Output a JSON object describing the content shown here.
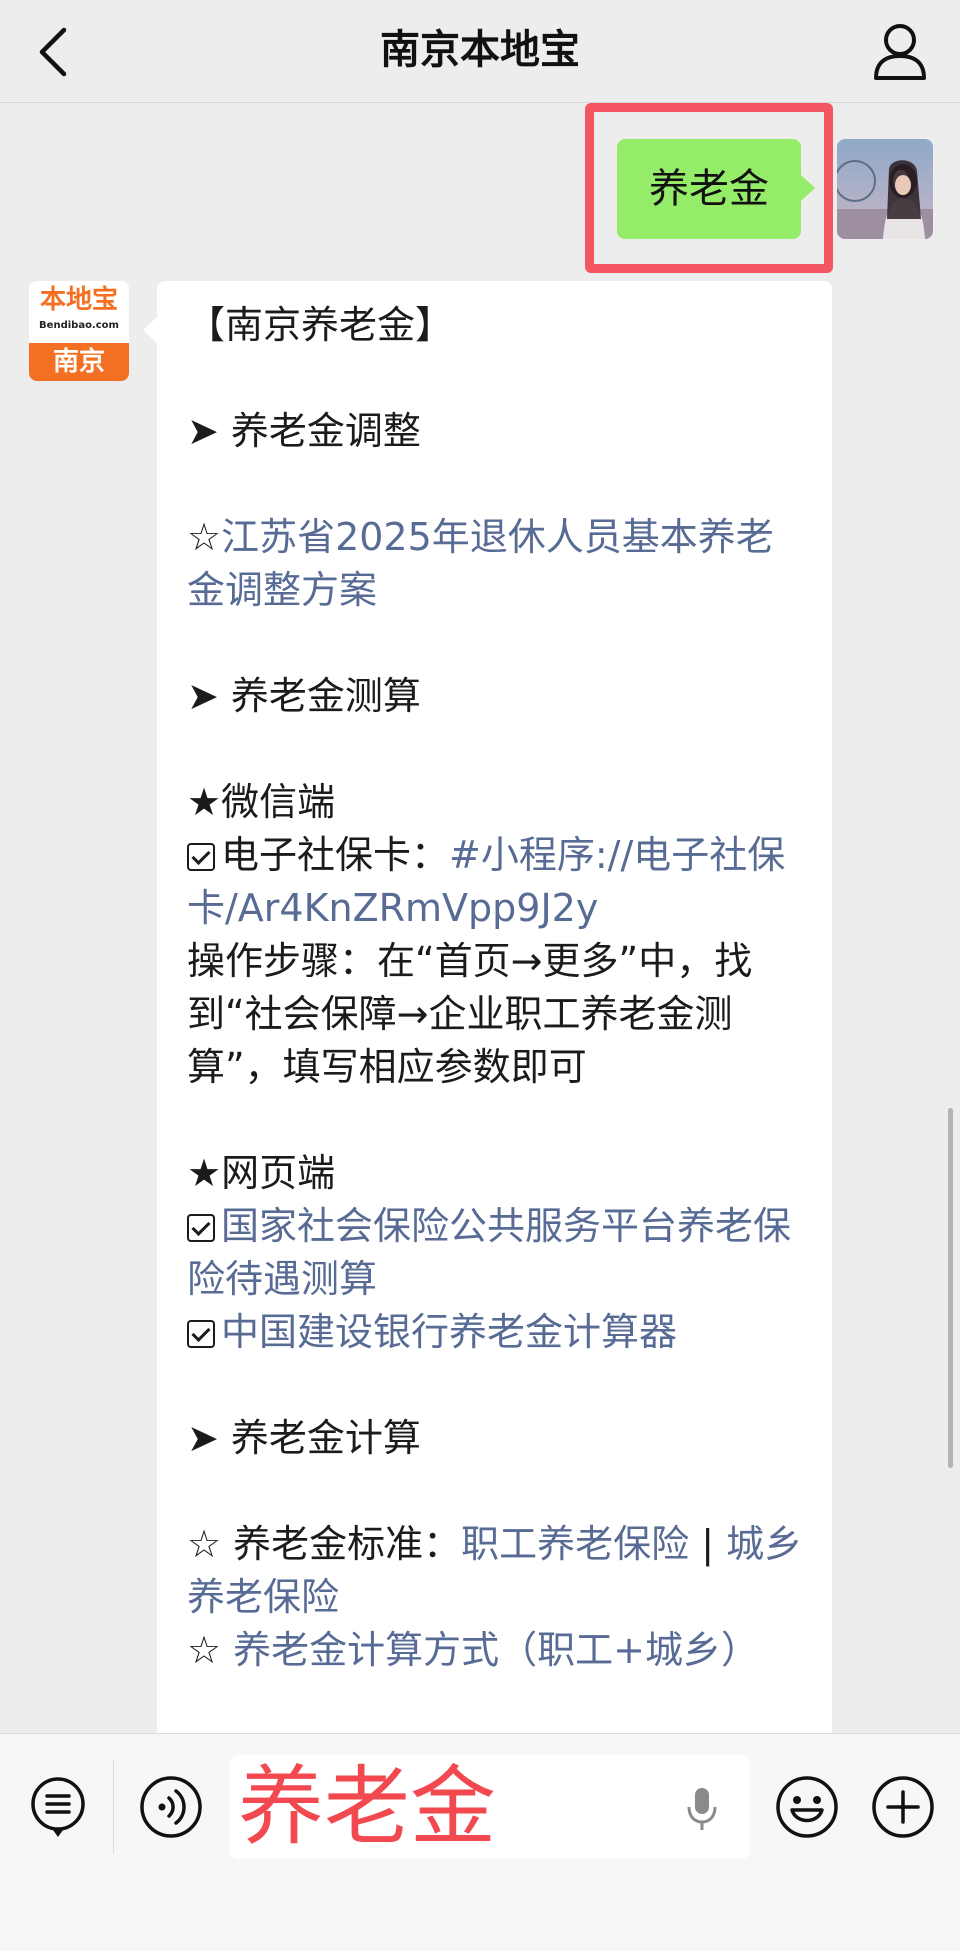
{
  "header": {
    "title": "南京本地宝"
  },
  "conversation": {
    "sent_message": "养老金",
    "bot_avatar": {
      "logo_text": "本地宝",
      "domain_text": "Bendibao.com",
      "city_text": "南京"
    },
    "reply": {
      "title": "【南京养老金】",
      "section1": "➤ 养老金调整",
      "item1_prefix": "☆",
      "item1_link": "江苏省2025年退休人员基本养老金调整方案",
      "section2": "➤ 养老金测算",
      "wechat_head": "★微信端",
      "ssc_label": "电子社保卡：",
      "ssc_link": "#小程序://电子社保卡/Ar4KnZRmVpp9J2y",
      "steps": "操作步骤：在“首页→更多”中，找到“社会保障→企业职工养老金测算”，填写相应参数即可",
      "web_head": "★网页端",
      "web_link1": "国家社会保险公共服务平台养老保险待遇测算",
      "web_link2": "中国建设银行养老金计算器",
      "section3": "➤ 养老金计算",
      "std_prefix": "☆ 养老金标准：",
      "std_link1": "职工养老保险",
      "std_sep": " | ",
      "std_link2": "城乡养老保险",
      "calc_prefix": "☆ ",
      "calc_link": "养老金计算方式（职工+城乡）"
    }
  },
  "input_bar": {
    "value": "养老金"
  },
  "colors": {
    "link": "#576b95",
    "sent_bubble": "#95ec69",
    "highlight": "#f45662",
    "input_text": "#f2484f"
  },
  "icons": {
    "back": "chevron-left-icon",
    "profile": "person-icon",
    "menu": "menu-list-icon",
    "voice": "voice-icon",
    "mic": "mic-icon",
    "emoji": "emoji-icon",
    "plus": "plus-icon"
  }
}
